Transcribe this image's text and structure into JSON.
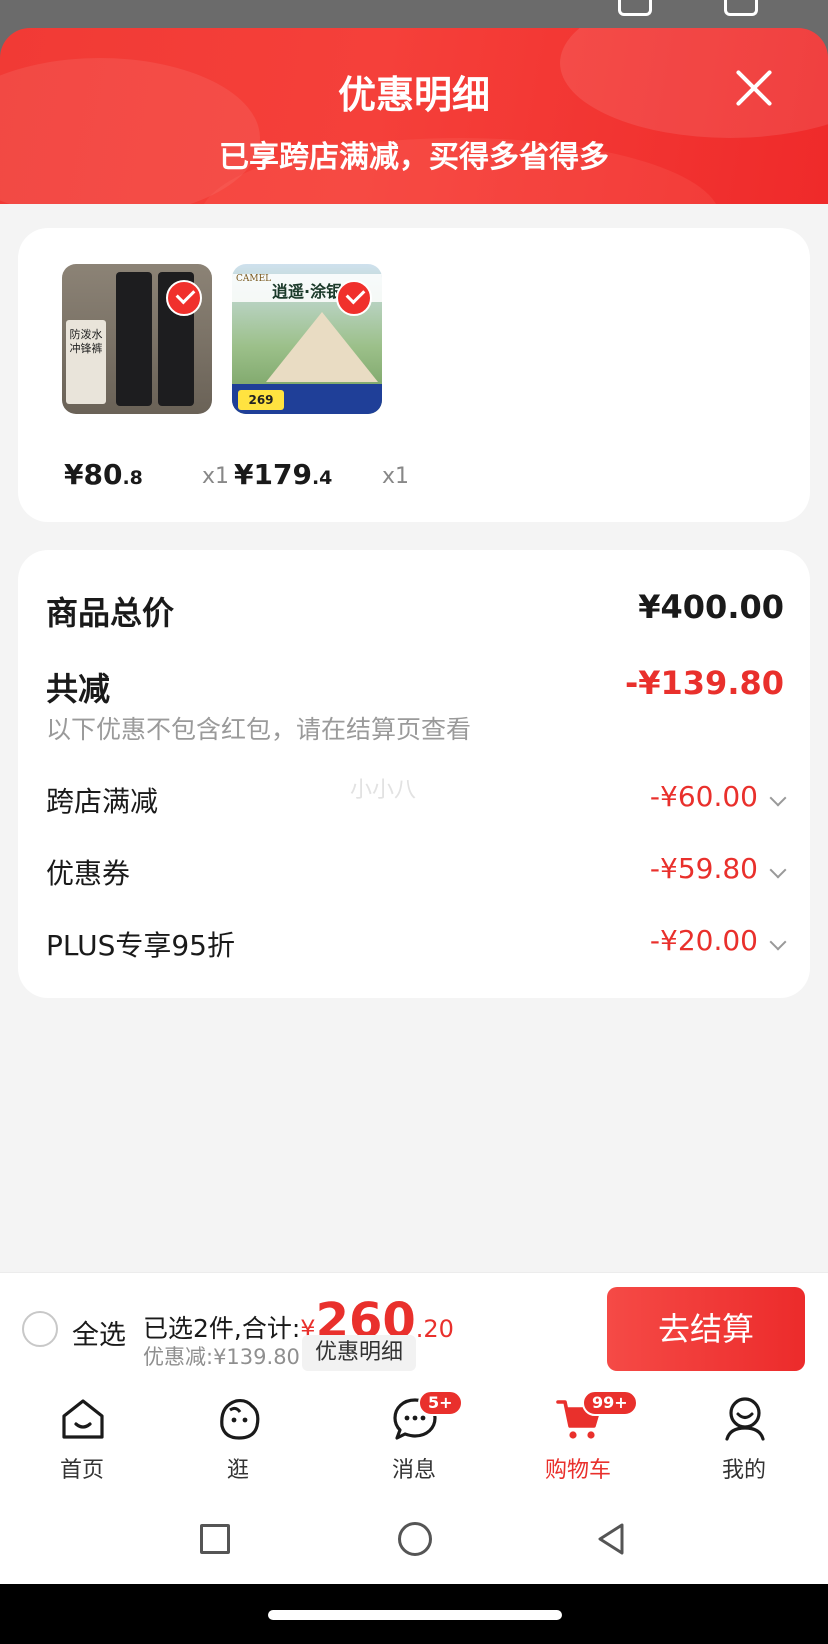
{
  "header": {
    "title": "优惠明细",
    "subtitle": "已享跨店满减，买得多省得多"
  },
  "products": [
    {
      "name": "pants",
      "thumb_text": "防泼水冲锋裤",
      "price_int": "¥80",
      "price_dec": ".8",
      "qty": "x1",
      "checked": true
    },
    {
      "name": "tent",
      "thumb_brand": "CAMEL",
      "thumb_text": "逍遥·涂银自",
      "thumb_price": "269",
      "price_int": "¥179",
      "price_dec": ".4",
      "qty": "x1",
      "checked": true
    }
  ],
  "summary": {
    "goods_total_label": "商品总价",
    "goods_total_value": "¥400.00",
    "total_reduce_label": "共减",
    "total_reduce_value": "-¥139.80",
    "note": "以下优惠不包含红包，请在结算页查看",
    "items": [
      {
        "label": "跨店满减",
        "value": "-¥60.00"
      },
      {
        "label": "优惠券",
        "value": "-¥59.80"
      },
      {
        "label": "PLUS专享95折",
        "value": "-¥20.00"
      }
    ],
    "watermark": "小小八"
  },
  "checkout": {
    "select_all": "全选",
    "selected_text": "已选2件,合计:",
    "total_symbol": "¥",
    "total_int": "260",
    "total_dec": ".20",
    "discount_text": "优惠减:¥139.80",
    "detail_chip": "优惠明细",
    "button": "去结算"
  },
  "tabs": [
    {
      "label": "首页",
      "icon": "home-icon",
      "active": false
    },
    {
      "label": "逛",
      "icon": "browse-icon",
      "active": false
    },
    {
      "label": "消息",
      "icon": "message-icon",
      "badge": "5+",
      "active": false
    },
    {
      "label": "购物车",
      "icon": "cart-icon",
      "badge": "99+",
      "active": true
    },
    {
      "label": "我的",
      "icon": "profile-icon",
      "active": false
    }
  ],
  "colors": {
    "accent": "#e9302c",
    "header_gradient_start": "#f13a35",
    "header_gradient_end": "#ef2a2a"
  }
}
